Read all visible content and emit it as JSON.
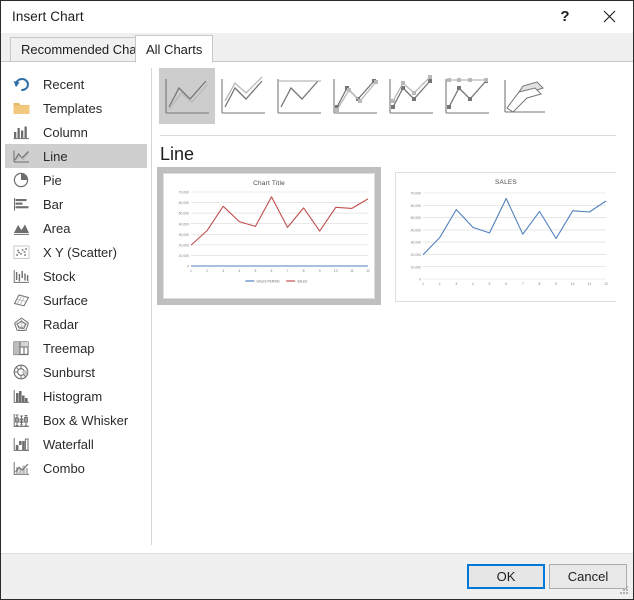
{
  "window": {
    "title": "Insert Chart",
    "help_label": "?",
    "close_label": "✕"
  },
  "tabs": [
    {
      "label": "Recommended Charts",
      "active": false
    },
    {
      "label": "All Charts",
      "active": true
    }
  ],
  "sidebar": {
    "items": [
      {
        "label": "Recent",
        "icon": "recent-icon",
        "selected": false
      },
      {
        "label": "Templates",
        "icon": "templates-icon",
        "selected": false
      },
      {
        "label": "Column",
        "icon": "column-chart-icon",
        "selected": false
      },
      {
        "label": "Line",
        "icon": "line-chart-icon",
        "selected": true
      },
      {
        "label": "Pie",
        "icon": "pie-chart-icon",
        "selected": false
      },
      {
        "label": "Bar",
        "icon": "bar-chart-icon",
        "selected": false
      },
      {
        "label": "Area",
        "icon": "area-chart-icon",
        "selected": false
      },
      {
        "label": "X Y (Scatter)",
        "icon": "scatter-chart-icon",
        "selected": false
      },
      {
        "label": "Stock",
        "icon": "stock-chart-icon",
        "selected": false
      },
      {
        "label": "Surface",
        "icon": "surface-chart-icon",
        "selected": false
      },
      {
        "label": "Radar",
        "icon": "radar-chart-icon",
        "selected": false
      },
      {
        "label": "Treemap",
        "icon": "treemap-chart-icon",
        "selected": false
      },
      {
        "label": "Sunburst",
        "icon": "sunburst-chart-icon",
        "selected": false
      },
      {
        "label": "Histogram",
        "icon": "histogram-chart-icon",
        "selected": false
      },
      {
        "label": "Box & Whisker",
        "icon": "box-whisker-icon",
        "selected": false
      },
      {
        "label": "Waterfall",
        "icon": "waterfall-chart-icon",
        "selected": false
      },
      {
        "label": "Combo",
        "icon": "combo-chart-icon",
        "selected": false
      }
    ]
  },
  "gallery": {
    "section_title": "Line",
    "subtypes": [
      {
        "name": "line",
        "selected": true
      },
      {
        "name": "stacked-line",
        "selected": false
      },
      {
        "name": "100-percent-stacked-line",
        "selected": false
      },
      {
        "name": "line-with-markers",
        "selected": false
      },
      {
        "name": "stacked-line-with-markers",
        "selected": false
      },
      {
        "name": "100-percent-stacked-line-with-markers",
        "selected": false
      },
      {
        "name": "3-d-line",
        "selected": false
      }
    ]
  },
  "colors": {
    "accent": "#0078d7",
    "series_sales": "#c0504d",
    "series_sales_period": "#4f81bd",
    "selection_gray": "#cfcfcf",
    "dialog_bg": "#f0f0f0"
  },
  "footer": {
    "ok_label": "OK",
    "cancel_label": "Cancel"
  },
  "chart_data": [
    {
      "type": "line",
      "title": "Chart Title",
      "xlabel": "",
      "ylabel": "",
      "x": [
        1,
        2,
        3,
        4,
        5,
        6,
        7,
        8,
        9,
        10,
        11,
        12
      ],
      "xticklabels": [
        "1",
        "2",
        "3",
        "4",
        "5",
        "6",
        "7",
        "8",
        "9",
        "10",
        "11",
        "12"
      ],
      "yticklabels": [
        "0",
        "10,000",
        "20,000",
        "30,000",
        "40,000",
        "50,000",
        "60,000",
        "70,000"
      ],
      "ylim": [
        0,
        70000
      ],
      "ytick_step": 10000,
      "grid": true,
      "legend": "bottom",
      "series": [
        {
          "name": "SALES PERIOD",
          "color": "#4f81bd",
          "values": [
            0,
            0,
            0,
            0,
            0,
            0,
            0,
            0,
            0,
            0,
            0,
            0
          ]
        },
        {
          "name": "SALES",
          "color": "#c0504d",
          "values": [
            19800,
            33500,
            56500,
            42000,
            37500,
            65500,
            36500,
            55000,
            33000,
            55500,
            54500,
            63500
          ]
        }
      ]
    },
    {
      "type": "line",
      "title": "SALES",
      "xlabel": "",
      "ylabel": "",
      "x": [
        1,
        2,
        3,
        4,
        5,
        6,
        7,
        8,
        9,
        10,
        11,
        12
      ],
      "xticklabels": [
        "1",
        "2",
        "3",
        "4",
        "5",
        "6",
        "7",
        "8",
        "9",
        "10",
        "11",
        "12"
      ],
      "yticklabels": [
        "0",
        "10,000",
        "20,000",
        "30,000",
        "40,000",
        "50,000",
        "60,000",
        "70,000"
      ],
      "ylim": [
        0,
        70000
      ],
      "ytick_step": 10000,
      "grid": true,
      "legend": "none",
      "series": [
        {
          "name": "SALES",
          "color": "#4f81bd",
          "values": [
            19800,
            33500,
            56500,
            42000,
            37500,
            65500,
            36500,
            55000,
            33000,
            55500,
            54500,
            63500
          ]
        }
      ]
    }
  ]
}
